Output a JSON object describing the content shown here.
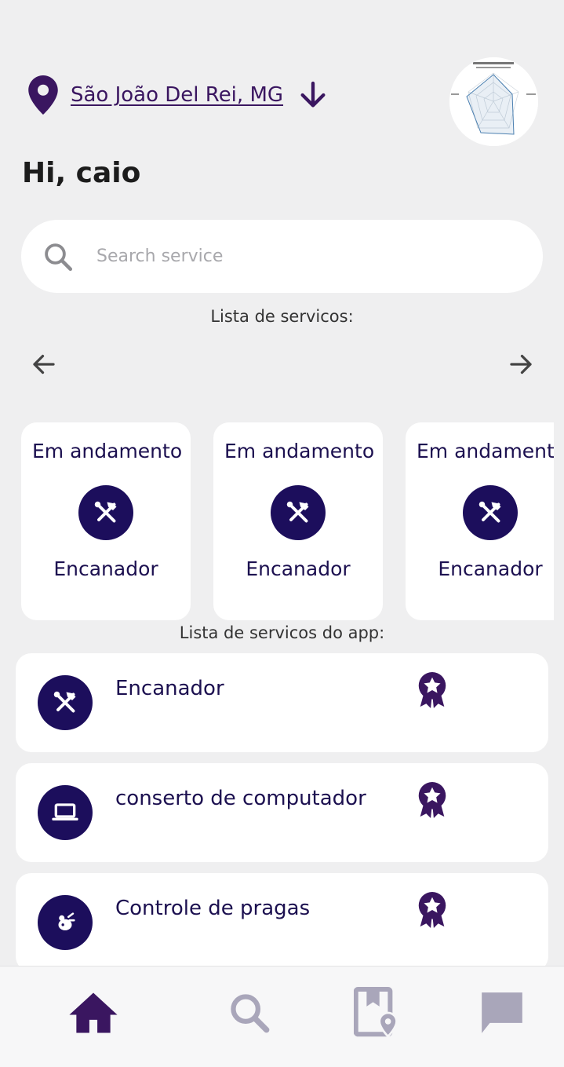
{
  "header": {
    "location": "São João Del Rei, MG"
  },
  "greeting": "Hi, caio",
  "search": {
    "placeholder": "Search service"
  },
  "services_label": "Lista de servicos:",
  "carousel": [
    {
      "status": "Em andamento",
      "name": "Encanador",
      "icon": "tools-icon"
    },
    {
      "status": "Em andamento",
      "name": "Encanador",
      "icon": "tools-icon"
    },
    {
      "status": "Em andamento",
      "name": "Encanador",
      "icon": "tools-icon"
    }
  ],
  "app_services_label": "Lista de servicos do app:",
  "app_services": [
    {
      "name": "Encanador",
      "icon": "tools-icon"
    },
    {
      "name": "conserto de computador",
      "icon": "laptop-icon"
    },
    {
      "name": "Controle de pragas",
      "icon": "pest-icon"
    }
  ],
  "bottom_nav": [
    {
      "icon": "home-icon",
      "active": true
    },
    {
      "icon": "search-icon",
      "active": false
    },
    {
      "icon": "map-book-icon",
      "active": false
    },
    {
      "icon": "chat-icon",
      "active": false
    }
  ],
  "colors": {
    "primary": "#1c0e5c",
    "accent_purple": "#3a1660",
    "inactive": "#a9a6ba",
    "background": "#efeff0"
  }
}
